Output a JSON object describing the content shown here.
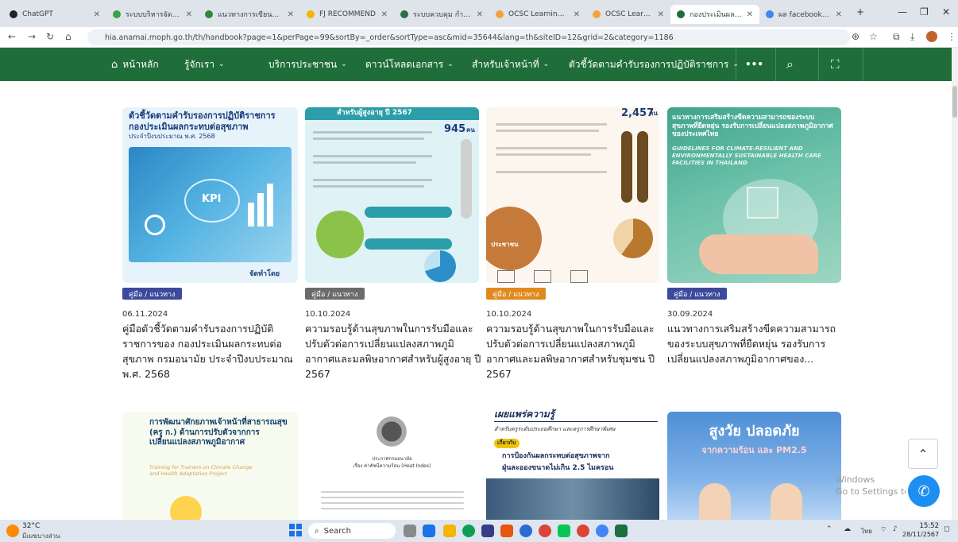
{
  "browser": {
    "tabs": [
      {
        "label": "ChatGPT",
        "color": "#222222",
        "active": false
      },
      {
        "label": "ระบบบริหารจัดการข้อมูล",
        "color": "#3aa04a",
        "active": false
      },
      {
        "label": "แนวทางการเขียนผลงาน",
        "color": "#2c8a3e",
        "active": false
      },
      {
        "label": "FJ RECOMMEND",
        "color": "#f4b400",
        "active": false
      },
      {
        "label": "ระบบควบคุม กำกับและติด",
        "color": "#2c6e49",
        "active": false
      },
      {
        "label": "OCSC Learning Portal",
        "color": "#f2a33a",
        "active": false
      },
      {
        "label": "OCSC Learning Space",
        "color": "#f2a33a",
        "active": false
      },
      {
        "label": "กองประเมินผลกระทบต่อ",
        "color": "#1f6e3a",
        "active": true
      },
      {
        "label": "ผล facebook - ค้นหา",
        "color": "#4285f4",
        "active": false
      }
    ],
    "new_tab": "+",
    "url": "hia.anamai.moph.go.th/th/handbook?page=1&perPage=99&sortBy=_order&sortType=asc&mid=35644&lang=th&siteID=12&grid=2&category=1186"
  },
  "site_nav": {
    "items": [
      {
        "label": "หน้าหลัก",
        "caret": false
      },
      {
        "label": "รู้จักเรา",
        "caret": true
      },
      {
        "label": "บริการประชาชน",
        "caret": true
      },
      {
        "label": "ดาวน์โหลดเอกสาร",
        "caret": true
      },
      {
        "label": "สำหรับเจ้าหน้าที่",
        "caret": true
      },
      {
        "label": "ตัวชี้วัดตามคำรับรองการปฏิบัติราชการ",
        "caret": true
      }
    ],
    "more": "•••"
  },
  "cards": [
    {
      "badge": "คู่มือ / แนวทาง",
      "badge_color": "#3b4a9c",
      "date": "06.11.2024",
      "title": "คู่มือตัวชี้วัดตามคำรับรองการปฏิบัติราชการของ กองประเมินผลกระทบต่อสุขภาพ กรมอนามัย ประจำปีงบประมาณ พ.ศ. 2568",
      "poster": {
        "title": "ตัวชี้วัดตามคำรับรองการปฏิบัติราชการ",
        "sub": "กองประเมินผลกระทบต่อสุขภาพ",
        "sub2": "ประจำปีงบประมาณ พ.ศ. 2568",
        "kpi": "KPI",
        "footer": "จัดทำโดย"
      }
    },
    {
      "badge": "คู่มือ / แนวทาง",
      "badge_color": "#6b6b6b",
      "date": "10.10.2024",
      "title": "ความรอบรู้ด้านสุขภาพในการรับมือและปรับตัวต่อการเปลี่ยนแปลงสภาพภูมิอากาศและมลพิษอากาศสำหรับผู้สูงอายุ ปี 2567",
      "poster": {
        "title": "สำหรับผู้สูงอายุ ปี 2567",
        "stat": "945",
        "unit": "คน"
      }
    },
    {
      "badge": "คู่มือ / แนวทาง",
      "badge_color": "#e08a1e",
      "date": "10.10.2024",
      "title": "ความรอบรู้ด้านสุขภาพในการรับมือและปรับตัวต่อการเปลี่ยนแปลงสภาพภูมิอากาศและมลพิษอากาศสำหรับชุมชน ปี 2567",
      "poster": {
        "title": "ประชาชน",
        "stat": "2,457",
        "unit": "คน"
      }
    },
    {
      "badge": "คู่มือ / แนวทาง",
      "badge_color": "#3b4a9c",
      "date": "30.09.2024",
      "title": "แนวทางการเสริมสร้างขีดความสามารถของระบบสุขภาพที่ยืดหยุ่น รองรับการเปลี่ยนแปลงสภาพภูมิอากาศของ...",
      "poster": {
        "title": "แนวทางการเสริมสร้างขีดความสามารถของระบบสุขภาพที่ยืดหยุ่น รองรับการเปลี่ยนแปลงสภาพภูมิอากาศของประเทศไทย",
        "en": "GUIDELINES FOR CLIMATE-RESILIENT AND ENVIRONMENTALLY SUSTAINABLE HEALTH CARE FACILITIES IN THAILAND"
      }
    }
  ],
  "row2": [
    {
      "title": "การพัฒนาศักยภาพเจ้าหน้าที่สาธารณสุข (ครู ก.) ด้านการปรับตัวจากการเปลี่ยนแปลงสภาพภูมิอากาศ",
      "en": "Training for Trainers on Climate Change and Health Adaptation Project"
    },
    {
      "title": "ประกาศกรมอนามัย",
      "sub": "เรื่อง ค่าดัชนีความร้อน (Heat Index)"
    },
    {
      "title": "เผยแพร่ความรู้",
      "sub": "สำหรับครูระดับประถมศึกษา และครูการศึกษาพิเศษ",
      "tag": "เกี่ยวกับ",
      "line1": "การป้องกันผลกระทบต่อสุขภาพจาก",
      "line2": "ฝุ่นละอองขนาดไม่เกิน 2.5 ไมครอน"
    },
    {
      "title": "สูงวัย ปลอดภัย",
      "sub": "จากความร้อน และ PM2.5"
    }
  ],
  "watermark": {
    "line1": "Windows",
    "line2": "Go to Settings to activate Windows."
  },
  "taskbar": {
    "weather_temp": "32°C",
    "weather_desc": "มีเมฆบางส่วน",
    "search": "Search",
    "time": "15:52",
    "date": "28/11/2567",
    "lang": "ไทย"
  }
}
